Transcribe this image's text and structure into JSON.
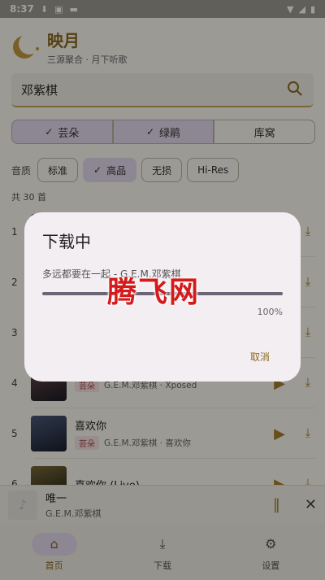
{
  "status": {
    "time": "8:37"
  },
  "app": {
    "name": "映月",
    "tagline": "三源聚合 · 月下听歌"
  },
  "search": {
    "value": "邓紫棋"
  },
  "sources": [
    {
      "label": "芸朵",
      "selected": true
    },
    {
      "label": "绿鹃",
      "selected": true
    },
    {
      "label": "库窝",
      "selected": false
    }
  ],
  "quality": {
    "label": "音质",
    "options": [
      {
        "label": "标准",
        "selected": false
      },
      {
        "label": "高品",
        "selected": true
      },
      {
        "label": "无损",
        "selected": false
      },
      {
        "label": "Hi-Res",
        "selected": false
      }
    ]
  },
  "results": {
    "count_label": "共 30 首",
    "items": [
      {
        "index": "1",
        "title": "",
        "tag": "",
        "meta": ""
      },
      {
        "index": "2",
        "title": "",
        "tag": "",
        "meta": ""
      },
      {
        "index": "3",
        "title": "",
        "tag": "",
        "meta": ""
      },
      {
        "index": "4",
        "title": "",
        "tag": "芸朵",
        "meta": "G.E.M.邓紫棋 · Xposed"
      },
      {
        "index": "5",
        "title": "喜欢你",
        "tag": "芸朵",
        "meta": "G.E.M.邓紫棋 · 喜欢你"
      },
      {
        "index": "6",
        "title": "喜欢你 (Live)",
        "tag": "",
        "meta": ""
      }
    ]
  },
  "now_playing": {
    "title": "唯一",
    "artist": "G.E.M.邓紫棋"
  },
  "nav": [
    {
      "label": "首页",
      "icon": "home-icon",
      "active": true
    },
    {
      "label": "下载",
      "icon": "download-icon",
      "active": false
    },
    {
      "label": "设置",
      "icon": "gear-icon",
      "active": false
    }
  ],
  "dialog": {
    "title": "下载中",
    "song": "多远都要在一起 - G.E.M.邓紫棋",
    "progress": 1.0,
    "percent_label": "100%",
    "cancel_label": "取消"
  },
  "watermark": "腾飞网",
  "colors": {
    "accent": "#8a6a1f",
    "selected_chip": "#e4d9ee",
    "watermark": "#d41a1a"
  }
}
